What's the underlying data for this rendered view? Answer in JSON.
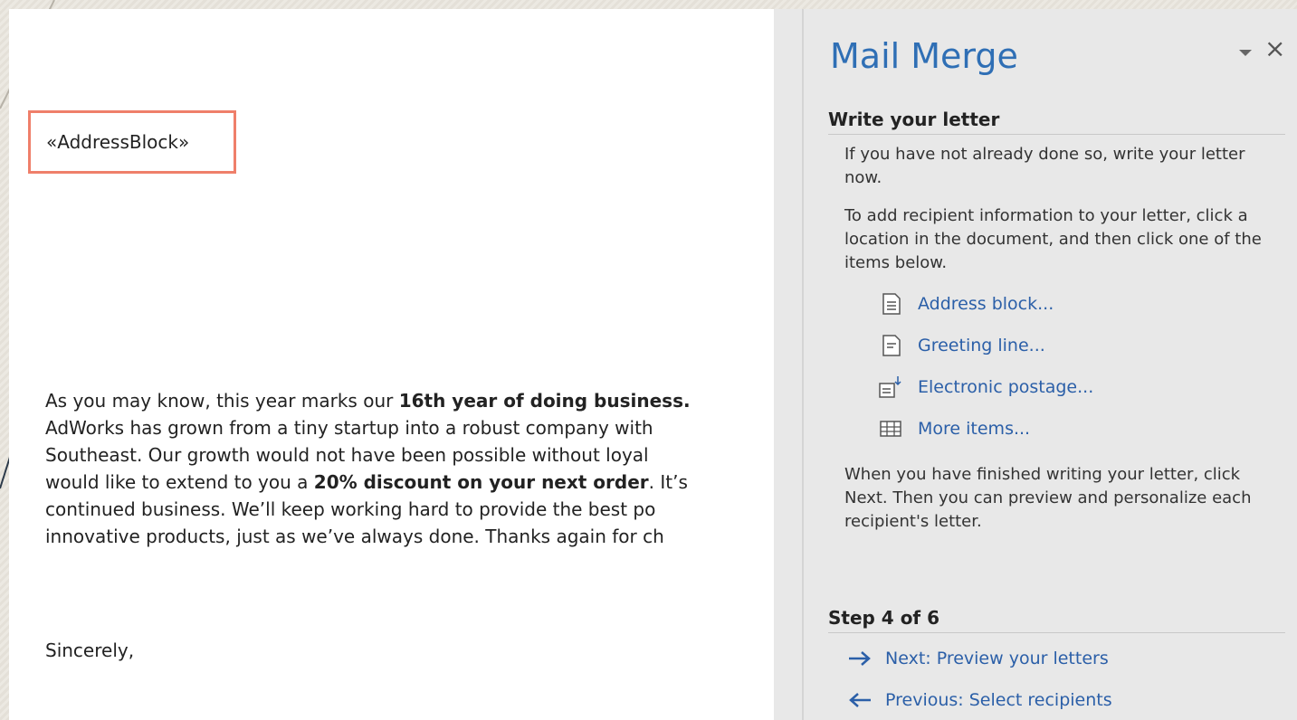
{
  "document": {
    "merge_field": "«AddressBlock»",
    "paragraph_lines": [
      {
        "parts": [
          "As you may know, this year marks our ",
          "16th year of doing business.",
          ""
        ]
      },
      {
        "parts": [
          "AdWorks has grown from a tiny startup into a robust company with",
          "",
          ""
        ]
      },
      {
        "parts": [
          "Southeast. Our growth would not have been possible without loyal",
          "",
          ""
        ]
      },
      {
        "parts": [
          "would like to extend to you a ",
          "20% discount on your next order",
          ". It’s"
        ]
      },
      {
        "parts": [
          "continued business. We’ll keep working hard to provide the best po",
          "",
          ""
        ]
      },
      {
        "parts": [
          "innovative products, just as we’ve always done. Thanks again for ch",
          "",
          ""
        ]
      }
    ],
    "closing": "Sincerely,"
  },
  "pane": {
    "title": "Mail Merge",
    "menu_icon": "dropdown-arrow-icon",
    "close_label": "×",
    "write_heading": "Write your letter",
    "intro": "If you have not already done so, write your letter now.",
    "instructions": "To add recipient information to your letter, click a location in the document, and then click one of the items below.",
    "items": [
      {
        "label": "Address block...",
        "icon": "address-block-icon"
      },
      {
        "label": "Greeting line...",
        "icon": "greeting-line-icon"
      },
      {
        "label": "Electronic postage...",
        "icon": "electronic-postage-icon"
      },
      {
        "label": "More items...",
        "icon": "more-items-icon"
      }
    ],
    "finish_text": "When you have finished writing your letter, click Next. Then you can preview and personalize each recipient's letter.",
    "step_heading": "Step 4 of 6",
    "next_label": "Next: Preview your letters",
    "previous_label": "Previous: Select recipients"
  },
  "colors": {
    "accent": "#2f6fb5",
    "link": "#2b5fa8",
    "highlight_border": "#ef7f6a"
  }
}
